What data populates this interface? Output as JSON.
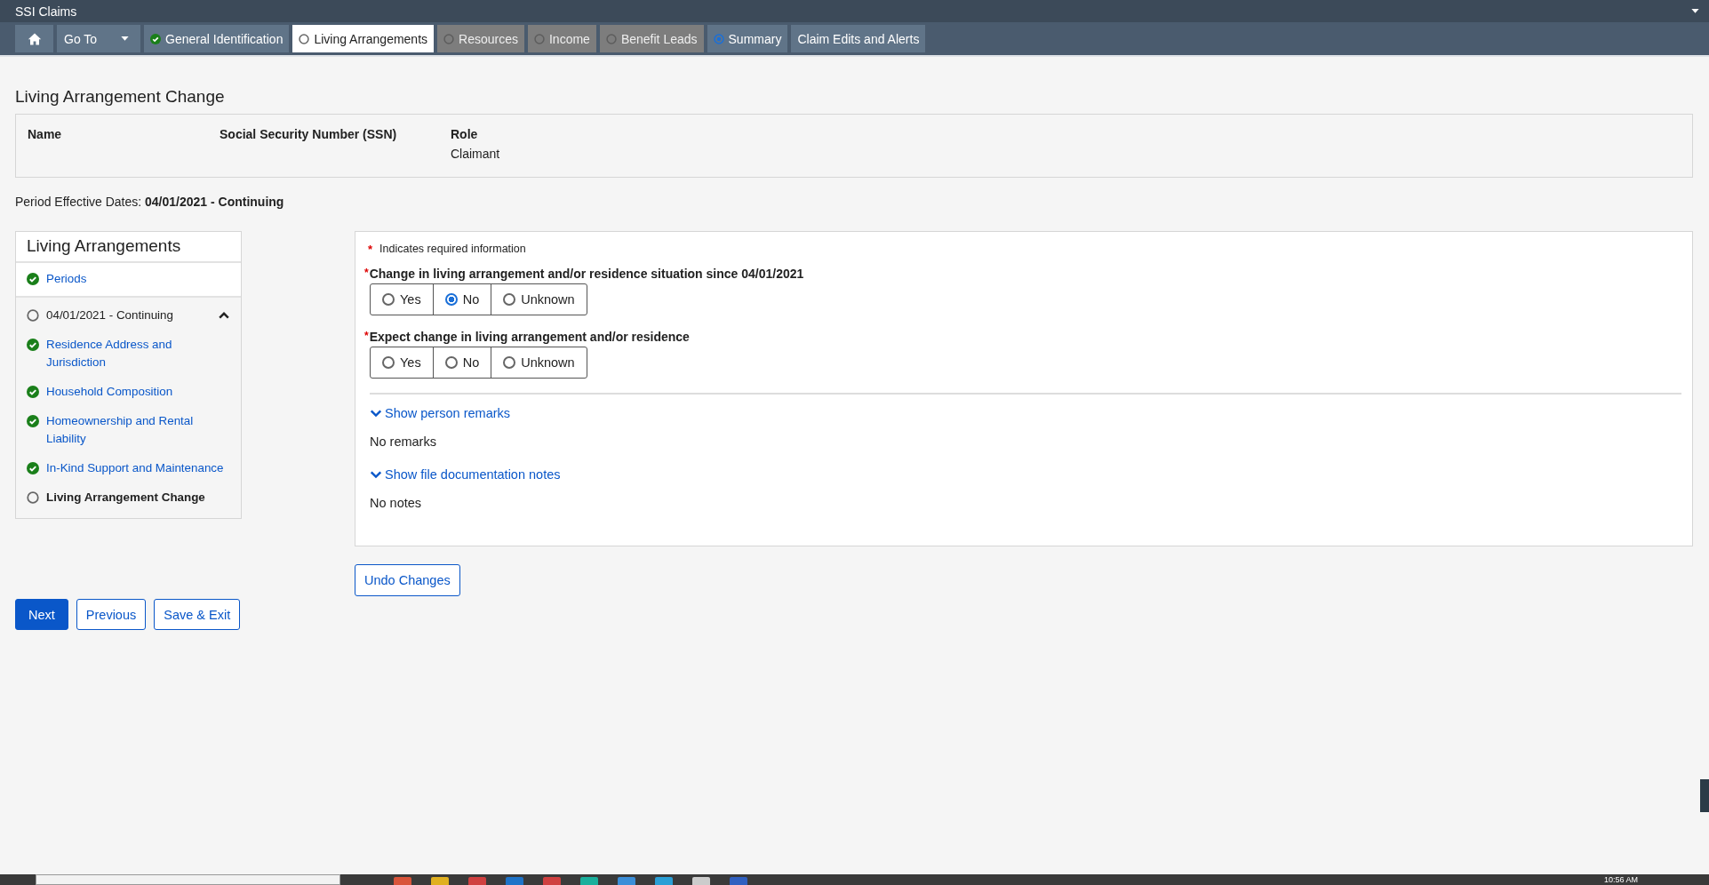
{
  "window": {
    "title": "SSI Claims"
  },
  "tabs": [
    {
      "kind": "home",
      "selected": false,
      "disabled": false
    },
    {
      "kind": "dropdown",
      "label": "Go To",
      "selected": false,
      "disabled": false
    },
    {
      "kind": "status",
      "label": "General Identification",
      "done": true,
      "current": false,
      "selected": false,
      "disabled": false
    },
    {
      "kind": "status",
      "label": "Living Arrangements",
      "done": false,
      "current": false,
      "selected": true,
      "disabled": false
    },
    {
      "kind": "status",
      "label": "Resources",
      "done": false,
      "current": false,
      "selected": false,
      "disabled": true
    },
    {
      "kind": "status",
      "label": "Income",
      "done": false,
      "current": false,
      "selected": false,
      "disabled": true
    },
    {
      "kind": "status",
      "label": "Benefit Leads",
      "done": false,
      "current": false,
      "selected": false,
      "disabled": true
    },
    {
      "kind": "status",
      "label": "Summary",
      "done": false,
      "current": true,
      "selected": false,
      "disabled": false
    },
    {
      "kind": "plain",
      "label": "Claim Edits and Alerts",
      "selected": false,
      "disabled": false
    }
  ],
  "page": {
    "title": "Living Arrangement Change",
    "person": {
      "columns": [
        {
          "label": "Name"
        },
        {
          "label": "Social Security Number (SSN)"
        },
        {
          "label": "Role",
          "value": "Claimant"
        }
      ]
    },
    "period_label": "Period Effective Dates:",
    "period_value": "04/01/2021 - Continuing"
  },
  "sidebar": {
    "title": "Living Arrangements",
    "items": [
      {
        "label": "Periods",
        "done": true,
        "selected": false
      },
      {
        "label": "04/01/2021 - Continuing",
        "done": false,
        "selected": false,
        "expanded": true,
        "children": [
          {
            "label": "Residence Address and Jurisdiction",
            "done": true,
            "selected": false
          },
          {
            "label": "Household Composition",
            "done": true,
            "selected": false
          },
          {
            "label": "Homeownership and Rental Liability",
            "done": true,
            "selected": false
          },
          {
            "label": "In-Kind Support and Maintenance",
            "done": true,
            "selected": false
          },
          {
            "label": "Living Arrangement Change",
            "done": false,
            "selected": true
          }
        ]
      }
    ]
  },
  "form": {
    "required_note": "Indicates required information",
    "required_mark": "*",
    "questions": [
      {
        "label": "Change in living arrangement and/or residence situation since 04/01/2021",
        "required": true,
        "options": [
          {
            "label": "Yes",
            "selected": false
          },
          {
            "label": "No",
            "selected": true
          },
          {
            "label": "Unknown",
            "selected": false
          }
        ]
      },
      {
        "label": "Expect change in living arrangement and/or residence",
        "required": true,
        "options": [
          {
            "label": "Yes",
            "selected": false
          },
          {
            "label": "No",
            "selected": false
          },
          {
            "label": "Unknown",
            "selected": false
          }
        ]
      }
    ],
    "sections": [
      {
        "toggle": "Show person remarks",
        "expanded": false,
        "text": "No remarks"
      },
      {
        "toggle": "Show file documentation notes",
        "expanded": false,
        "text": "No notes"
      }
    ],
    "undo_button": "Undo Changes"
  },
  "buttons": [
    {
      "label": "Next",
      "kind": "primary"
    },
    {
      "label": "Previous",
      "kind": "secondary"
    },
    {
      "label": "Save & Exit",
      "kind": "secondary"
    }
  ],
  "taskbar": {
    "clock": "10:56 AM"
  }
}
